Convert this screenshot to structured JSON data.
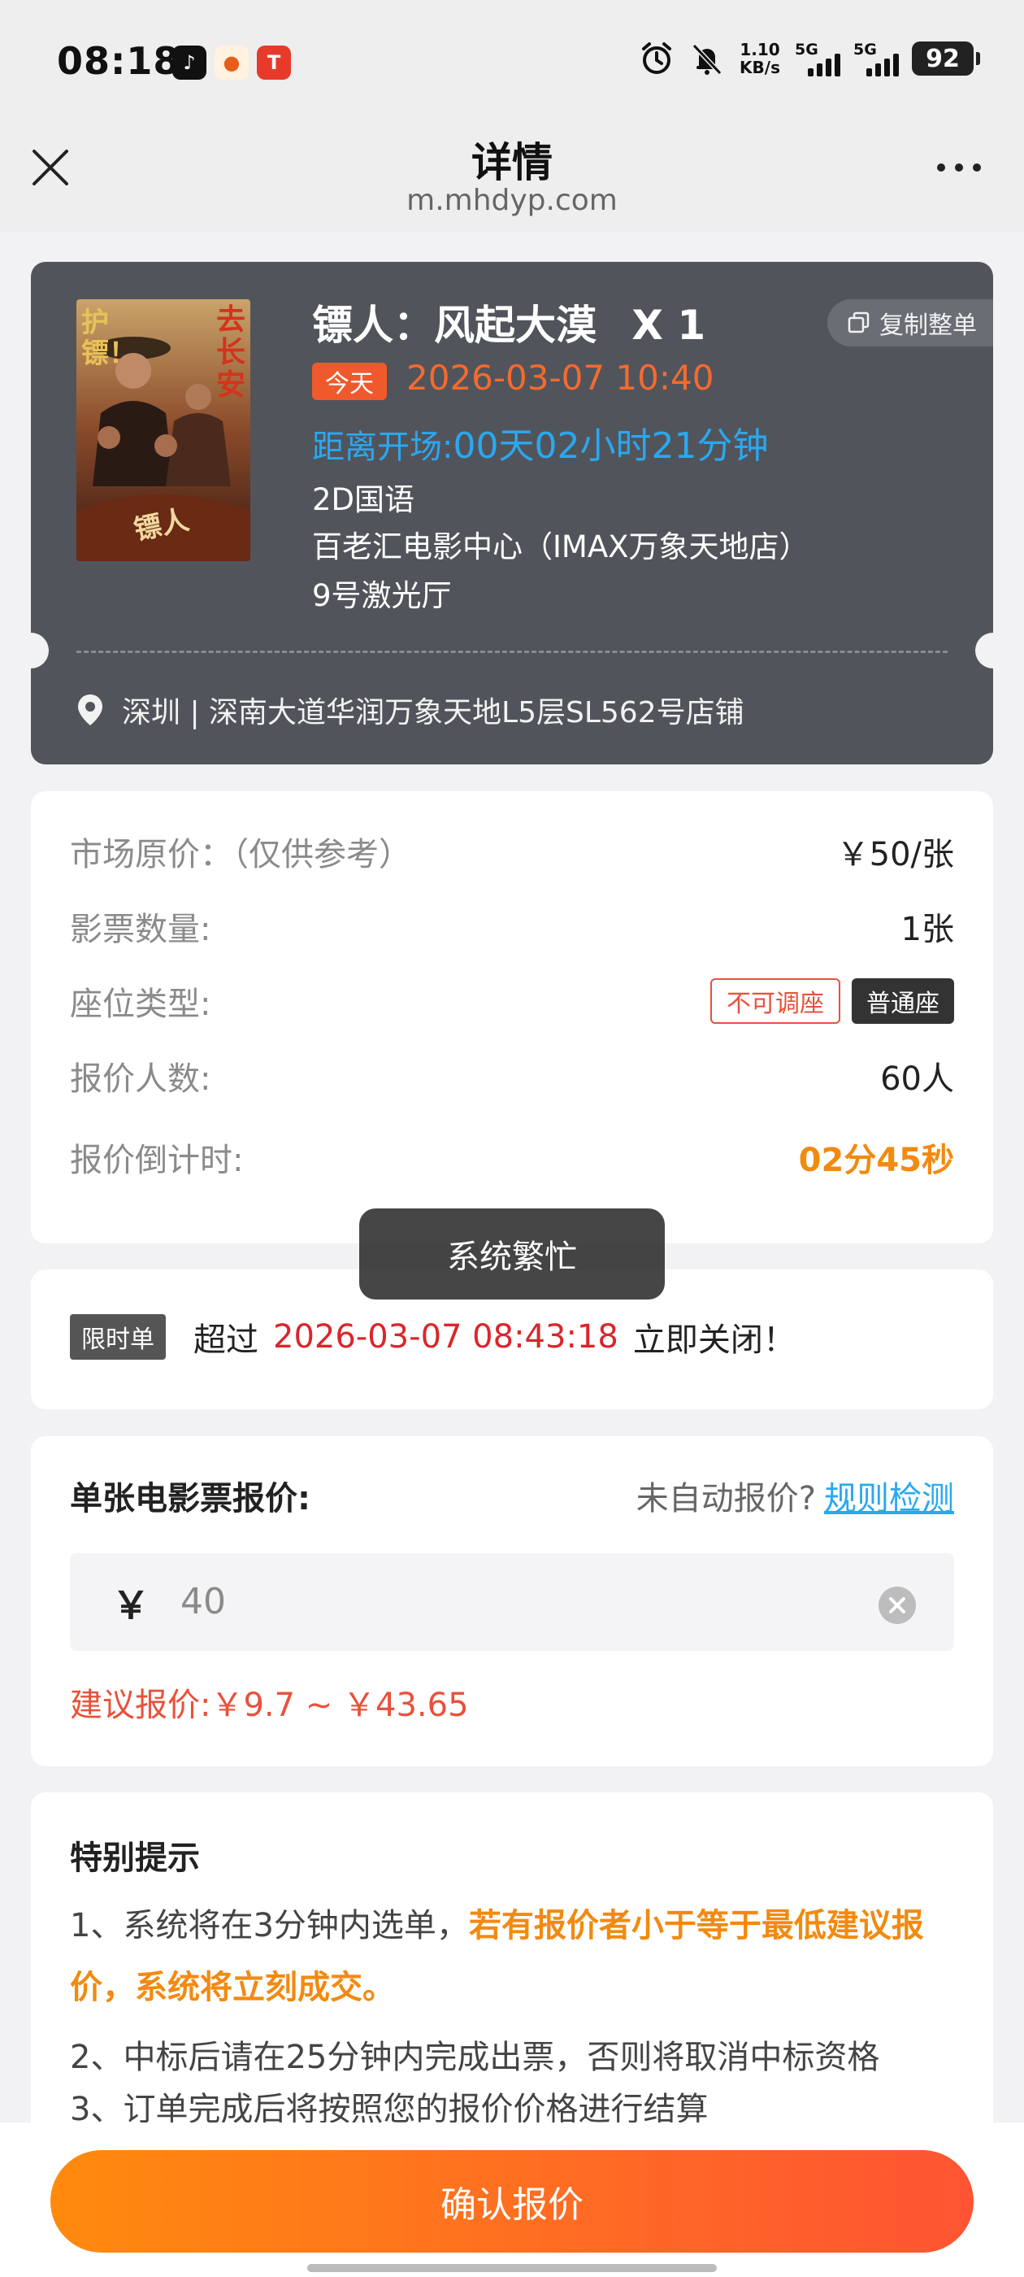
{
  "status_bar": {
    "time": "08:18",
    "net_speed_value": "1.10",
    "net_speed_unit": "KB/s",
    "network1": "5G",
    "network2": "5G",
    "battery": "92"
  },
  "nav": {
    "title": "详情",
    "url": "m.mhdyp.com"
  },
  "ticket": {
    "title": "镖人：风起大漠",
    "quantity": "X 1",
    "copy_label": "复制整单",
    "today_badge": "今天",
    "show_time": "2026-03-07 10:40",
    "countdown_label": "距离开场:",
    "countdown_value": "00天02小时21分钟",
    "format": "2D国语",
    "cinema": "百老汇电影中心（IMAX万象天地店）",
    "hall": "9号激光厅",
    "address": "深圳 | 深南大道华润万象天地L5层SL562号店铺",
    "poster_text_left": "护镖！",
    "poster_text_right": "去长安",
    "poster_text_bottom": "镖人"
  },
  "details": {
    "market_price_label": "市场原价：（仅供参考）",
    "market_price_value": "￥50/张",
    "ticket_count_label": "影票数量:",
    "ticket_count_value": "1张",
    "seat_type_label": "座位类型:",
    "seat_tag_1": "不可调座",
    "seat_tag_2": "普通座",
    "bidders_label": "报价人数:",
    "bidders_value": "60人",
    "bid_countdown_label": "报价倒计时:",
    "bid_countdown_value": "02分45秒"
  },
  "toast": "系统繁忙",
  "limit": {
    "tag": "限时单",
    "prefix": "超过",
    "deadline": "2026-03-07 08:43:18",
    "suffix": "立即关闭！"
  },
  "quote": {
    "title": "单张电影票报价:",
    "auto_question": "未自动报价?",
    "rule_link": "规则检测",
    "currency": "￥",
    "input_value": "40",
    "suggestion": "建议报价:￥9.7 ~ ￥43.65"
  },
  "tips": {
    "title": "特别提示",
    "tip1_prefix": "1、系统将在3分钟内选单，",
    "tip1_highlight": "若有报价者小于等于最低建议报价，系统将立刻成交。",
    "tip2": "2、中标后请在25分钟内完成出票，否则将取消中标资格",
    "tip3": "3、订单完成后将按照您的报价价格进行结算"
  },
  "confirm_button": "确认报价",
  "colors": {
    "accent_orange": "#f28a10",
    "ticket_bg": "#52545b",
    "link_blue": "#2aa8f0",
    "alert_red": "#d9262b"
  }
}
